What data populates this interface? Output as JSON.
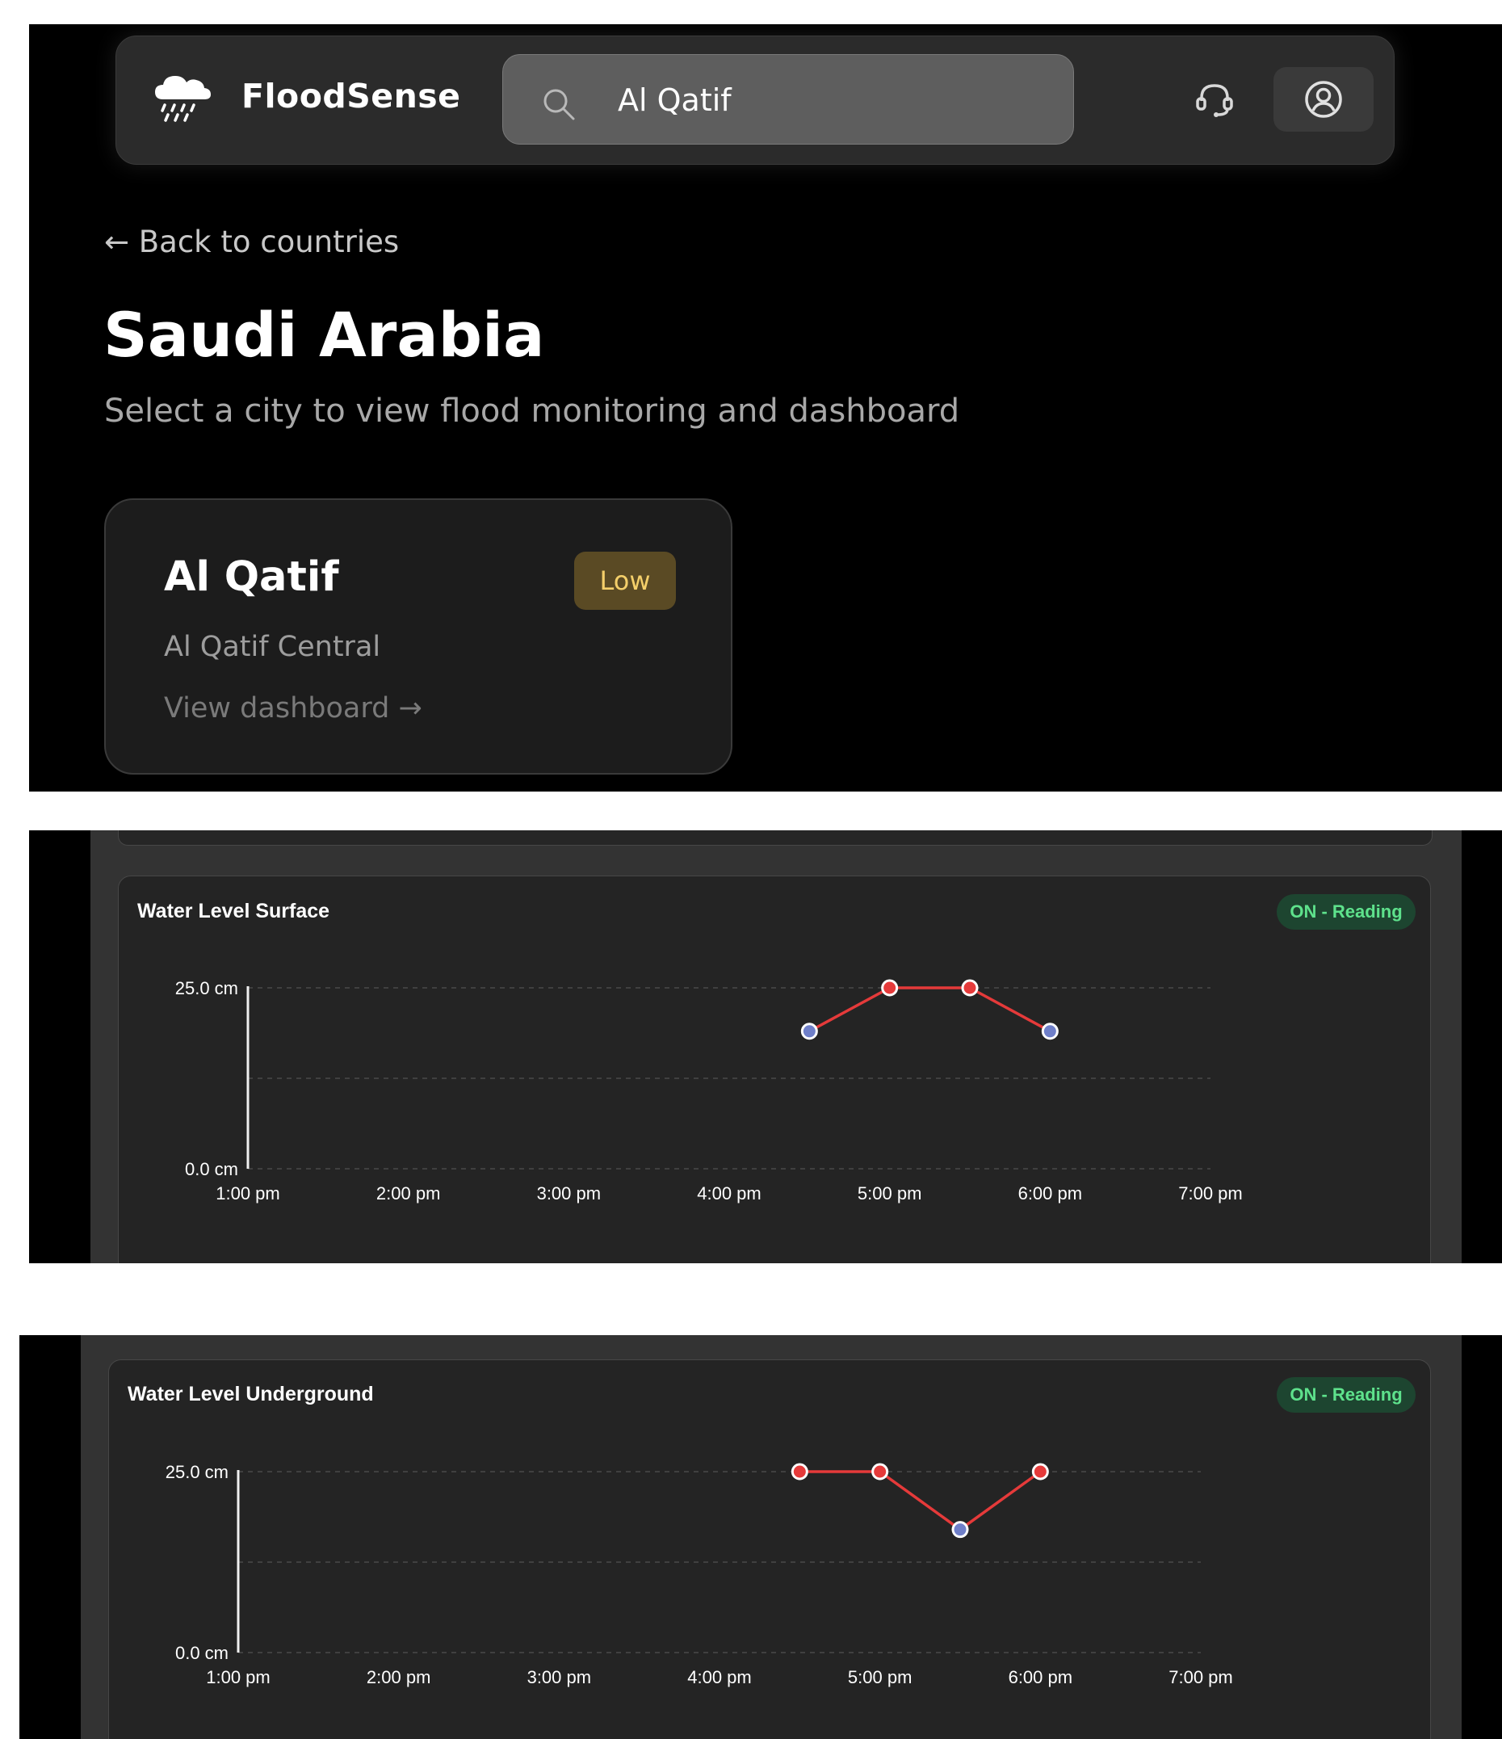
{
  "header": {
    "brand": "FloodSense",
    "search": {
      "value": "Al Qatif",
      "placeholder": ""
    }
  },
  "icons": {
    "brand": "rain-cloud-icon",
    "search": "search-icon",
    "support": "headset-icon",
    "account": "user-circle-icon"
  },
  "back_link": "← Back to countries",
  "page": {
    "title": "Saudi Arabia",
    "subtitle": "Select a city to view flood monitoring and dashboard"
  },
  "city_card": {
    "name": "Al Qatif",
    "risk": "Low",
    "district": "Al Qatif Central",
    "link": "View dashboard →"
  },
  "colors": {
    "line": "#e53a3a",
    "point_high": "#e53a3a",
    "point_low": "#6f7fc9",
    "status_bg": "#1d4530",
    "status_text": "#5ee28c",
    "badge_bg": "#5a4a24",
    "badge_text": "#f4cf6a"
  },
  "charts": [
    {
      "title": "Water Level Surface",
      "status": "ON - Reading"
    },
    {
      "title": "Water Level Underground",
      "status": "ON - Reading"
    }
  ],
  "chart_data": [
    {
      "type": "line",
      "title": "Water Level Surface",
      "xlabel": "",
      "ylabel": "",
      "x_ticks": [
        "1:00 pm",
        "2:00 pm",
        "3:00 pm",
        "4:00 pm",
        "5:00 pm",
        "6:00 pm",
        "7:00 pm"
      ],
      "y_ticks": [
        "0.0 cm",
        "25.0 cm"
      ],
      "xlim": [
        "13:00",
        "19:00"
      ],
      "ylim": [
        0,
        25
      ],
      "x": [
        "16:30",
        "17:00",
        "17:30",
        "18:00"
      ],
      "values": [
        19,
        25,
        25,
        19
      ],
      "grid": true
    },
    {
      "type": "line",
      "title": "Water Level Underground",
      "xlabel": "",
      "ylabel": "",
      "x_ticks": [
        "1:00 pm",
        "2:00 pm",
        "3:00 pm",
        "4:00 pm",
        "5:00 pm",
        "6:00 pm",
        "7:00 pm"
      ],
      "y_ticks": [
        "0.0 cm",
        "25.0 cm"
      ],
      "xlim": [
        "13:00",
        "19:00"
      ],
      "ylim": [
        0,
        25
      ],
      "x": [
        "16:30",
        "17:00",
        "17:30",
        "18:00"
      ],
      "values": [
        25,
        25,
        17,
        25
      ],
      "grid": true
    }
  ]
}
